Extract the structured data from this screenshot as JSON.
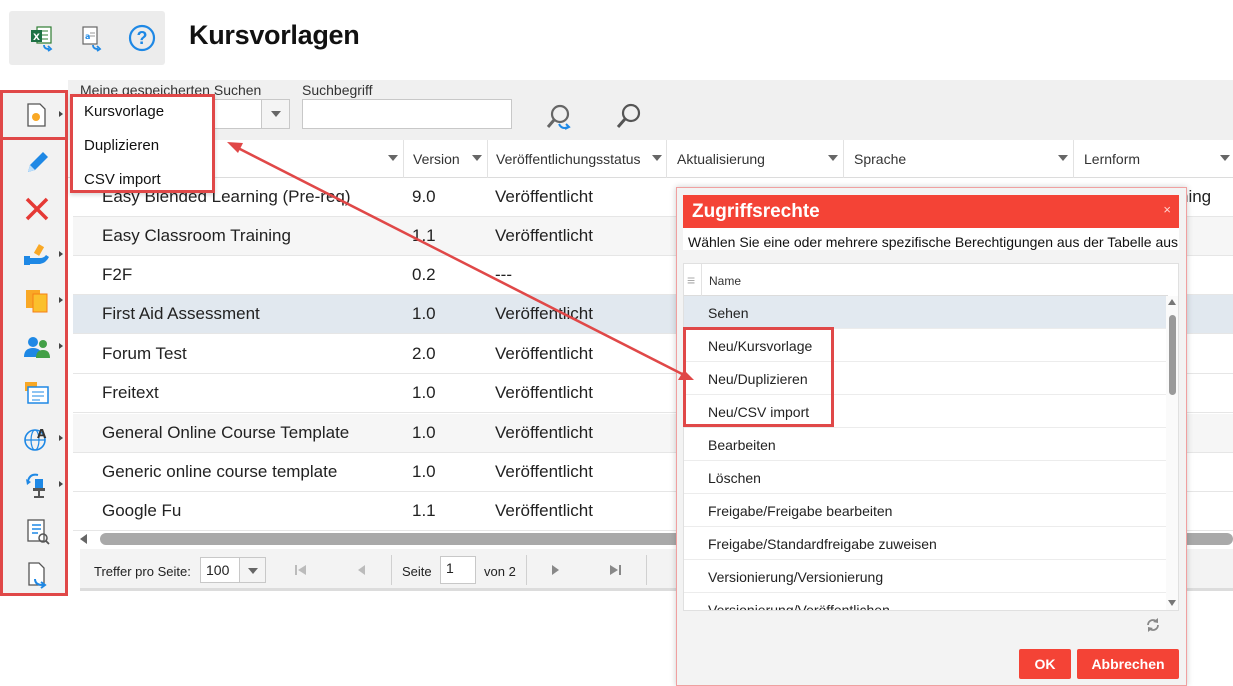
{
  "page": {
    "title": "Kursvorlagen"
  },
  "toolbar": {
    "icons": [
      "excel-export-icon",
      "text-export-icon",
      "help-icon"
    ],
    "help_glyph": "?"
  },
  "sidebar": {
    "icons": [
      "new-document-icon",
      "edit-pencil-icon",
      "delete-x-icon",
      "assign-hand-icon",
      "copy-pages-icon",
      "users-icon",
      "card-file-icon",
      "language-icon",
      "chair-restore-icon",
      "report-list-icon",
      "document-export-icon"
    ]
  },
  "search": {
    "saved_label": "Meine gespeicherten Suchen",
    "term_label": "Suchbegriff",
    "saved_value": "",
    "term_value": ""
  },
  "menu": {
    "items": [
      "Kursvorlage",
      "Duplizieren",
      "CSV import"
    ]
  },
  "table": {
    "columns": [
      "Version",
      "Veröffentlichungsstatus",
      "Aktualisierung",
      "Sprache",
      "Lernform"
    ],
    "rows": [
      {
        "name": "Easy Blended Learning (Pre-req)",
        "version": "9.0",
        "status": "Veröffentlicht",
        "extra": "ning"
      },
      {
        "name": "Easy Classroom Training",
        "version": "1.1",
        "status": "Veröffentlicht",
        "extra": ""
      },
      {
        "name": "F2F",
        "version": "0.2",
        "status": "---",
        "extra": ""
      },
      {
        "name": "First Aid Assessment",
        "version": "1.0",
        "status": "Veröffentlicht",
        "extra": ""
      },
      {
        "name": "Forum Test",
        "version": "2.0",
        "status": "Veröffentlicht",
        "extra": ""
      },
      {
        "name": "Freitext",
        "version": "1.0",
        "status": "Veröffentlicht",
        "extra": ""
      },
      {
        "name": "General Online Course Template",
        "version": "1.0",
        "status": "Veröffentlicht",
        "extra": ""
      },
      {
        "name": "Generic online course template",
        "version": "1.0",
        "status": "Veröffentlicht",
        "extra": ""
      },
      {
        "name": "Google Fu",
        "version": "1.1",
        "status": "Veröffentlicht",
        "extra": ""
      }
    ]
  },
  "pager": {
    "per_page_label": "Treffer pro Seite:",
    "per_page": "100",
    "page_label": "Seite",
    "page": "1",
    "of_label": "von 2"
  },
  "dialog": {
    "title": "Zugriffsrechte",
    "close": "×",
    "description": "Wählen Sie eine oder mehrere spezifische Berechtigungen aus der Tabelle aus",
    "column": "Name",
    "rows": [
      "Sehen",
      "Neu/Kursvorlage",
      "Neu/Duplizieren",
      "Neu/CSV import",
      "Bearbeiten",
      "Löschen",
      "Freigabe/Freigabe bearbeiten",
      "Freigabe/Standardfreigabe zuweisen",
      "Versionierung/Versionierung",
      "Versionierung/Veröffentlichen"
    ],
    "ok": "OK",
    "cancel": "Abbrechen"
  },
  "colors": {
    "accent": "#f44336",
    "highlight": "#e04848"
  }
}
